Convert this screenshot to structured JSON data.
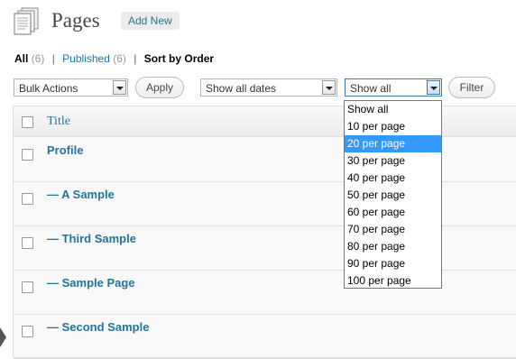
{
  "header": {
    "title": "Pages",
    "add_new_label": "Add New"
  },
  "views": {
    "all_label": "All",
    "all_count": "(6)",
    "published_label": "Published",
    "published_count": "(6)",
    "separator": "|",
    "sort_label": "Sort by Order"
  },
  "toolbar": {
    "bulk_actions_value": "Bulk Actions",
    "apply_label": "Apply",
    "dates_value": "Show all dates",
    "per_page_value": "Show all",
    "filter_label": "Filter"
  },
  "per_page_options": [
    "Show all",
    "10 per page",
    "20 per page",
    "30 per page",
    "40 per page",
    "50 per page",
    "60 per page",
    "70 per page",
    "80 per page",
    "90 per page",
    "100 per page"
  ],
  "per_page_highlighted": "20 per page",
  "table": {
    "column_title": "Title",
    "rows": [
      "Profile",
      "— A Sample",
      "— Third Sample",
      "— Sample Page",
      "— Second Sample"
    ]
  },
  "icons": {
    "page": "pages-icon",
    "dropdown": "chevron-down-icon",
    "checkbox": "checkbox-icon"
  },
  "colors": {
    "link": "#21759b",
    "highlight": "#3399ff"
  }
}
